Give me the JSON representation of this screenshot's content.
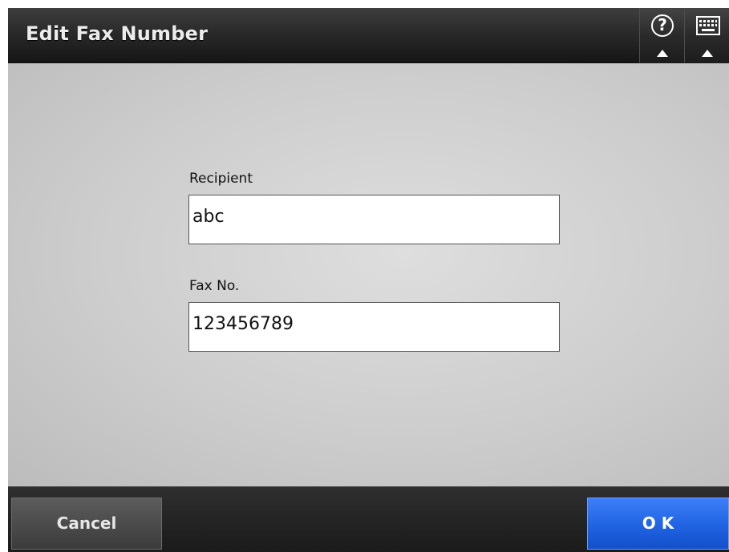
{
  "header": {
    "title": "Edit Fax Number",
    "help_glyph": "?",
    "icons": [
      "help-icon",
      "keyboard-icon"
    ]
  },
  "form": {
    "recipient": {
      "label": "Recipient",
      "value": "abc"
    },
    "fax_no": {
      "label": "Fax No.",
      "value": "123456789"
    }
  },
  "footer": {
    "cancel_label": "Cancel",
    "ok_label": "O K"
  },
  "colors": {
    "ok_button": "#2063e2",
    "header_bg": "#2a2a2a",
    "content_bg": "#cdcdcd"
  }
}
